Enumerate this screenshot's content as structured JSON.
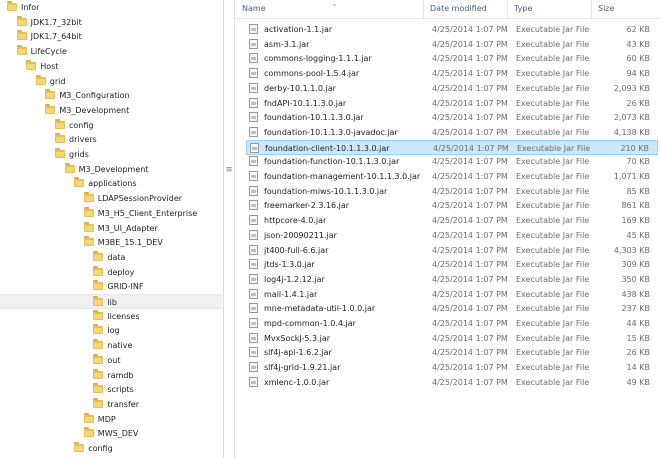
{
  "tree": [
    {
      "label": "Infor",
      "level": 0
    },
    {
      "label": "JDK1.7_32bit",
      "level": 1
    },
    {
      "label": "JDK1.7_64bit",
      "level": 1
    },
    {
      "label": "LifeCycle",
      "level": 1
    },
    {
      "label": "Host",
      "level": 2
    },
    {
      "label": "grid",
      "level": 3
    },
    {
      "label": "M3_Configuration",
      "level": 4
    },
    {
      "label": "M3_Development",
      "level": 4
    },
    {
      "label": "config",
      "level": 5
    },
    {
      "label": "drivers",
      "level": 5
    },
    {
      "label": "grids",
      "level": 5
    },
    {
      "label": "M3_Development",
      "level": 6
    },
    {
      "label": "applications",
      "level": 7
    },
    {
      "label": "LDAPSessionProvider",
      "level": 8
    },
    {
      "label": "M3_H5_Client_Enterprise",
      "level": 8
    },
    {
      "label": "M3_UI_Adapter",
      "level": 8
    },
    {
      "label": "M3BE_15.1_DEV",
      "level": 8
    },
    {
      "label": "data",
      "level": 9
    },
    {
      "label": "deploy",
      "level": 9
    },
    {
      "label": "GRID-INF",
      "level": 9
    },
    {
      "label": "lib",
      "level": 9,
      "selected": true
    },
    {
      "label": "licenses",
      "level": 9
    },
    {
      "label": "log",
      "level": 9
    },
    {
      "label": "native",
      "level": 9
    },
    {
      "label": "out",
      "level": 9
    },
    {
      "label": "ramdb",
      "level": 9
    },
    {
      "label": "scripts",
      "level": 9
    },
    {
      "label": "transfer",
      "level": 9
    },
    {
      "label": "MDP",
      "level": 8
    },
    {
      "label": "MWS_DEV",
      "level": 8
    },
    {
      "label": "config",
      "level": 7
    }
  ],
  "columns": {
    "name": "Name",
    "date": "Date modified",
    "type": "Type",
    "size": "Size"
  },
  "splitter_grip": "≡",
  "sort_arrow": "^",
  "files": [
    {
      "name": "activation-1.1.jar",
      "date": "4/25/2014 1:07 PM",
      "type": "Executable Jar File",
      "size": "62 KB"
    },
    {
      "name": "asm-3.1.jar",
      "date": "4/25/2014 1:07 PM",
      "type": "Executable Jar File",
      "size": "43 KB"
    },
    {
      "name": "commons-logging-1.1.1.jar",
      "date": "4/25/2014 1:07 PM",
      "type": "Executable Jar File",
      "size": "60 KB"
    },
    {
      "name": "commons-pool-1.5.4.jar",
      "date": "4/25/2014 1:07 PM",
      "type": "Executable Jar File",
      "size": "94 KB"
    },
    {
      "name": "derby-10.1.1.0.jar",
      "date": "4/25/2014 1:07 PM",
      "type": "Executable Jar File",
      "size": "2,093 KB"
    },
    {
      "name": "fndAPI-10.1.1.3.0.jar",
      "date": "4/25/2014 1:07 PM",
      "type": "Executable Jar File",
      "size": "26 KB"
    },
    {
      "name": "foundation-10.1.1.3.0.jar",
      "date": "4/25/2014 1:07 PM",
      "type": "Executable Jar File",
      "size": "2,073 KB"
    },
    {
      "name": "foundation-10.1.1.3.0-javadoc.jar",
      "date": "4/25/2014 1:07 PM",
      "type": "Executable Jar File",
      "size": "4,138 KB"
    },
    {
      "name": "foundation-client-10.1.1.3.0.jar",
      "date": "4/25/2014 1:07 PM",
      "type": "Executable Jar File",
      "size": "210 KB",
      "selected": true
    },
    {
      "name": "foundation-function-10.1.1.3.0.jar",
      "date": "4/25/2014 1:07 PM",
      "type": "Executable Jar File",
      "size": "70 KB"
    },
    {
      "name": "foundation-management-10.1.1.3.0.jar",
      "date": "4/25/2014 1:07 PM",
      "type": "Executable Jar File",
      "size": "1,071 KB"
    },
    {
      "name": "foundation-miws-10.1.1.3.0.jar",
      "date": "4/25/2014 1:07 PM",
      "type": "Executable Jar File",
      "size": "85 KB"
    },
    {
      "name": "freemarker-2.3.16.jar",
      "date": "4/25/2014 1:07 PM",
      "type": "Executable Jar File",
      "size": "861 KB"
    },
    {
      "name": "httpcore-4.0.jar",
      "date": "4/25/2014 1:07 PM",
      "type": "Executable Jar File",
      "size": "169 KB"
    },
    {
      "name": "json-20090211.jar",
      "date": "4/25/2014 1:07 PM",
      "type": "Executable Jar File",
      "size": "45 KB"
    },
    {
      "name": "jt400-full-6.6.jar",
      "date": "4/25/2014 1:07 PM",
      "type": "Executable Jar File",
      "size": "4,303 KB"
    },
    {
      "name": "jtds-1.3.0.jar",
      "date": "4/25/2014 1:07 PM",
      "type": "Executable Jar File",
      "size": "309 KB"
    },
    {
      "name": "log4j-1.2.12.jar",
      "date": "4/25/2014 1:07 PM",
      "type": "Executable Jar File",
      "size": "350 KB"
    },
    {
      "name": "mail-1.4.1.jar",
      "date": "4/25/2014 1:07 PM",
      "type": "Executable Jar File",
      "size": "438 KB"
    },
    {
      "name": "mne-metadata-util-1.0.0.jar",
      "date": "4/25/2014 1:07 PM",
      "type": "Executable Jar File",
      "size": "237 KB"
    },
    {
      "name": "mpd-common-1.0.4.jar",
      "date": "4/25/2014 1:07 PM",
      "type": "Executable Jar File",
      "size": "44 KB"
    },
    {
      "name": "MvxSockJ-5.3.jar",
      "date": "4/25/2014 1:07 PM",
      "type": "Executable Jar File",
      "size": "15 KB"
    },
    {
      "name": "slf4j-api-1.6.2.jar",
      "date": "4/25/2014 1:07 PM",
      "type": "Executable Jar File",
      "size": "26 KB"
    },
    {
      "name": "slf4j-grid-1.9.21.jar",
      "date": "4/25/2014 1:07 PM",
      "type": "Executable Jar File",
      "size": "14 KB"
    },
    {
      "name": "xmlenc-1.0.0.jar",
      "date": "4/25/2014 1:07 PM",
      "type": "Executable Jar File",
      "size": "49 KB"
    }
  ]
}
